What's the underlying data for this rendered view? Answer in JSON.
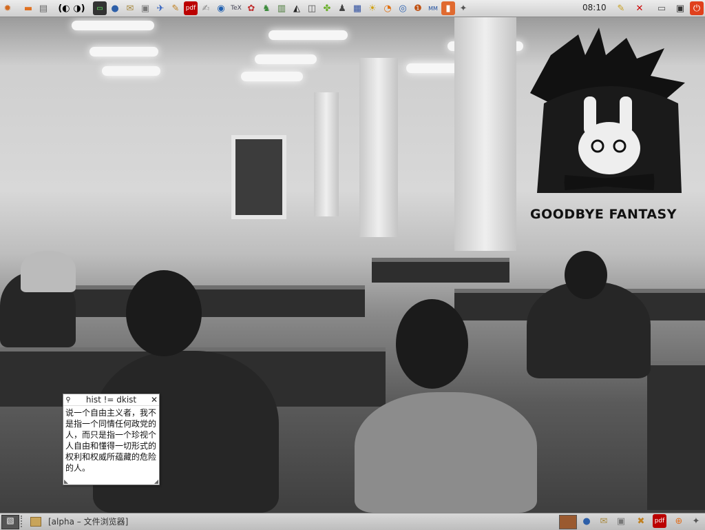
{
  "top_panel": {
    "launchers": [
      "ubuntu-menu-icon",
      "home-folder-icon",
      "show-desktop-icon",
      "sep",
      "workspace-icon",
      "workspace-icon-2",
      "sep",
      "terminal-icon",
      "web-browser-icon",
      "mail-icon",
      "file-manager-icon",
      "bird-app-icon",
      "pencil-icon",
      "pdf-reader-icon",
      "text-editor-icon",
      "network-icon",
      "tex-editor-icon",
      "image-viewer-icon",
      "game-icon",
      "books-icon",
      "inkscape-icon",
      "scanner-icon",
      "puzzle-icon",
      "tux-icon",
      "chip-icon",
      "sun-icon",
      "blender-icon",
      "compass-icon",
      "coffee-icon",
      "mindmap-icon",
      "office-icon",
      "sheep-icon"
    ],
    "clock": "08:10",
    "tray": [
      "notes-tray-icon",
      "volume-tray-icon",
      "keyboard-tray-icon",
      "display-tray-icon",
      "power-icon"
    ]
  },
  "note": {
    "title": "hist != dkist",
    "body": "说一个自由主义者，我不是指一个同情任何政党的人，而只是指一个珍视个人自由和懂得一切形式的权利和权威所蕴藏的危险的人。"
  },
  "wallpaper": {
    "logo_text": "GOODBYE FANTASY"
  },
  "bottom_panel": {
    "task": "[alpha – 文件浏览器]",
    "tray": [
      "show-desktop-button",
      "browser-tray-icon",
      "mail-tray-icon",
      "files-tray-icon",
      "game-tray-icon",
      "pdf-tray-icon",
      "trash-icon",
      "sheep-tray-icon"
    ]
  },
  "colors": {
    "panel": "#d6d6d6",
    "note_bg": "#ffffff",
    "power": "#e0401c"
  }
}
